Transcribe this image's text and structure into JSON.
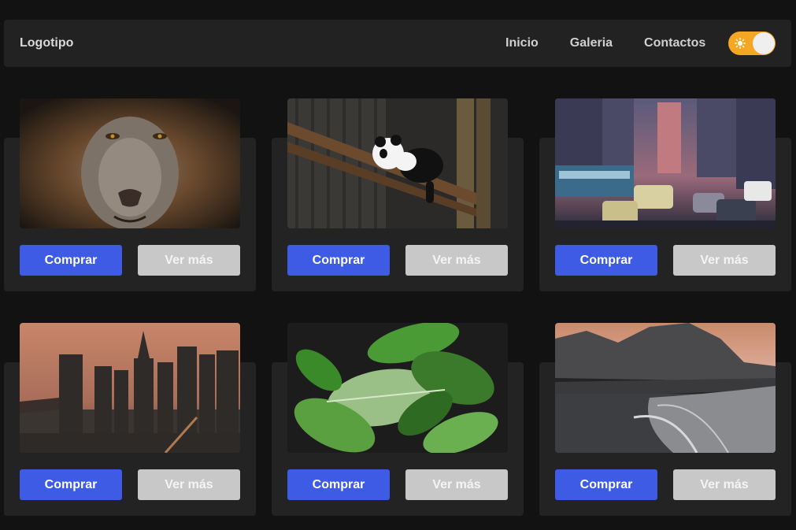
{
  "navbar": {
    "logo": "Logotipo",
    "links": [
      "Inicio",
      "Galeria",
      "Contactos"
    ],
    "theme_toggle_icon": "sun-icon"
  },
  "cards": [
    {
      "image": "lion",
      "buy_label": "Comprar",
      "more_label": "Ver más"
    },
    {
      "image": "panda",
      "buy_label": "Comprar",
      "more_label": "Ver más"
    },
    {
      "image": "city-traffic",
      "buy_label": "Comprar",
      "more_label": "Ver más"
    },
    {
      "image": "city-skyline",
      "buy_label": "Comprar",
      "more_label": "Ver más"
    },
    {
      "image": "leaves",
      "buy_label": "Comprar",
      "more_label": "Ver más"
    },
    {
      "image": "mountain-beach",
      "buy_label": "Comprar",
      "more_label": "Ver más"
    }
  ],
  "colors": {
    "background": "#121212",
    "surface": "#232323",
    "primary": "#3d5be5",
    "secondary": "#c8c8c8",
    "toggle": "#f5a623"
  }
}
